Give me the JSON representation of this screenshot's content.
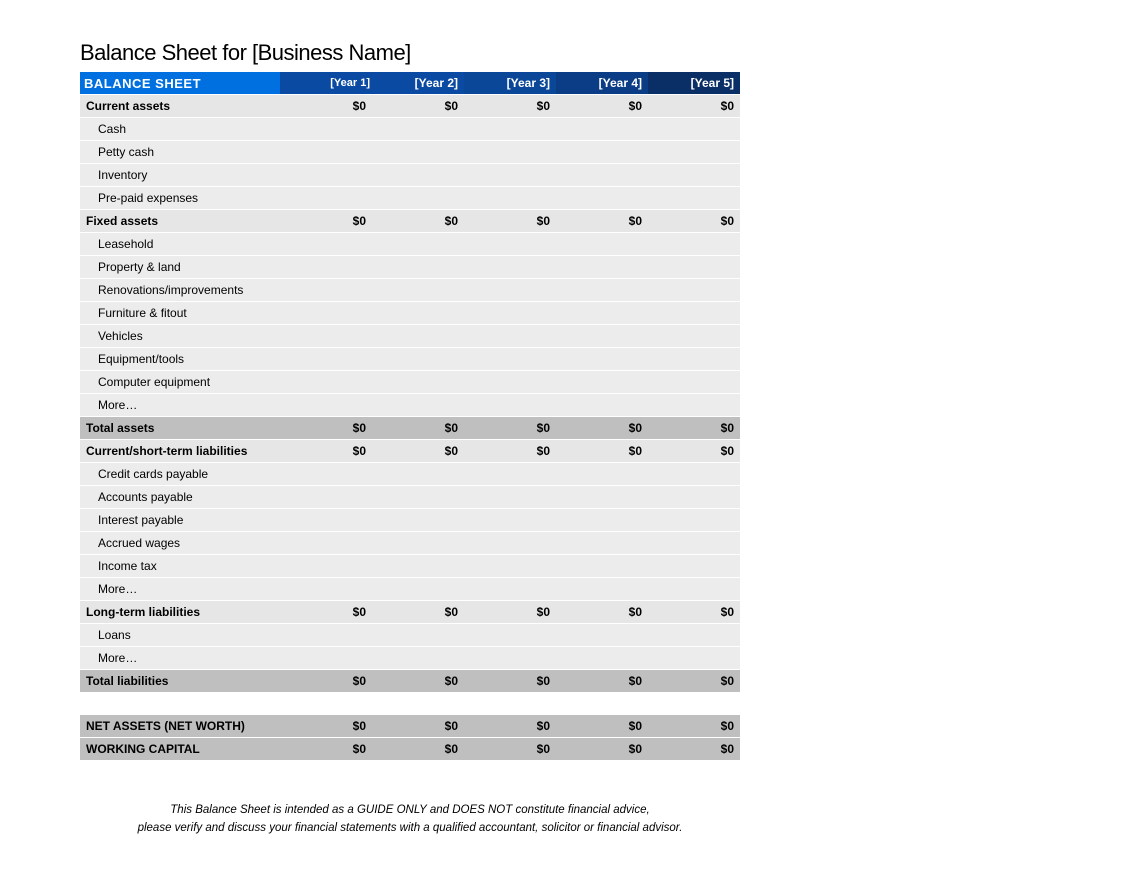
{
  "title": "Balance Sheet for [Business Name]",
  "header": {
    "title": "BALANCE SHEET",
    "years": [
      "[Year 1]",
      "[Year 2]",
      "[Year 3]",
      "[Year 4]",
      "[Year 5]"
    ]
  },
  "sections": {
    "current_assets": {
      "label": "Current assets",
      "values": [
        "$0",
        "$0",
        "$0",
        "$0",
        "$0"
      ],
      "items": [
        {
          "label": "Cash"
        },
        {
          "label": "Petty cash"
        },
        {
          "label": "Inventory"
        },
        {
          "label": "Pre-paid expenses"
        }
      ]
    },
    "fixed_assets": {
      "label": "Fixed assets",
      "values": [
        "$0",
        "$0",
        "$0",
        "$0",
        "$0"
      ],
      "items": [
        {
          "label": "Leasehold"
        },
        {
          "label": "Property & land"
        },
        {
          "label": "Renovations/improvements"
        },
        {
          "label": "Furniture & fitout"
        },
        {
          "label": "Vehicles"
        },
        {
          "label": "Equipment/tools"
        },
        {
          "label": "Computer equipment"
        },
        {
          "label": "More…"
        }
      ]
    },
    "total_assets": {
      "label": "Total assets",
      "values": [
        "$0",
        "$0",
        "$0",
        "$0",
        "$0"
      ]
    },
    "current_liabilities": {
      "label": "Current/short-term liabilities",
      "values": [
        "$0",
        "$0",
        "$0",
        "$0",
        "$0"
      ],
      "items": [
        {
          "label": "Credit cards payable"
        },
        {
          "label": "Accounts payable"
        },
        {
          "label": "Interest payable"
        },
        {
          "label": "Accrued wages"
        },
        {
          "label": "Income tax"
        },
        {
          "label": "More…"
        }
      ]
    },
    "long_term_liabilities": {
      "label": "Long-term liabilities",
      "values": [
        "$0",
        "$0",
        "$0",
        "$0",
        "$0"
      ],
      "items": [
        {
          "label": "Loans"
        },
        {
          "label": "More…"
        }
      ]
    },
    "total_liabilities": {
      "label": "Total liabilities",
      "values": [
        "$0",
        "$0",
        "$0",
        "$0",
        "$0"
      ]
    },
    "net_assets": {
      "label": "NET ASSETS (NET WORTH)",
      "values": [
        "$0",
        "$0",
        "$0",
        "$0",
        "$0"
      ]
    },
    "working_capital": {
      "label": "WORKING CAPITAL",
      "values": [
        "$0",
        "$0",
        "$0",
        "$0",
        "$0"
      ]
    }
  },
  "disclaimer": {
    "line1": "This Balance Sheet is intended as a GUIDE ONLY and DOES NOT constitute financial advice,",
    "line2": "please verify and discuss your financial statements with a qualified accountant, solicitor or financial advisor."
  }
}
